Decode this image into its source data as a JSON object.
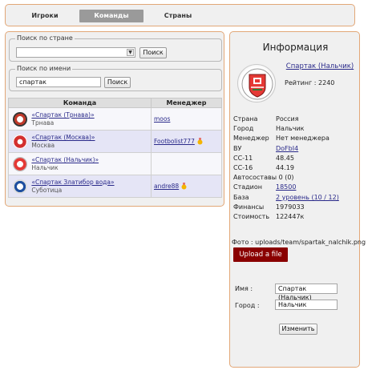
{
  "tabs": [
    {
      "label": "Игроки",
      "active": false
    },
    {
      "label": "Команды",
      "active": true
    },
    {
      "label": "Страны",
      "active": false
    }
  ],
  "search_country": {
    "legend": "Поиск по стране",
    "value": "",
    "button": "Поиск"
  },
  "search_name": {
    "legend": "Поиск по имени",
    "value": "спартак",
    "button": "Поиск"
  },
  "table": {
    "headers": [
      "Команда",
      "Менеджер"
    ],
    "rows": [
      {
        "name": "«Спартак (Трнава)»",
        "city": "Трнава",
        "manager": "moos",
        "medal": false,
        "logo_color": "#c0392b"
      },
      {
        "name": "«Спартак (Москва)»",
        "city": "Москва",
        "manager": "Footbolist777",
        "medal": true,
        "logo_color": "#d32f2f"
      },
      {
        "name": "«Спартак (Нальчик)»",
        "city": "Нальчик",
        "manager": "",
        "medal": false,
        "logo_color": "#e53935"
      },
      {
        "name": "«Спартак Златибор вода»",
        "city": "Суботица",
        "manager": "andre88",
        "medal": true,
        "logo_color": "#1e4fa0"
      }
    ]
  },
  "info": {
    "title": "Информация",
    "team": "Спартак (Нальчик)",
    "rating": "Рейтинг : 2240",
    "fields": [
      {
        "k": "Страна",
        "v": "Россия",
        "link": false
      },
      {
        "k": "Город",
        "v": "Нальчик",
        "link": false
      },
      {
        "k": "Менеджер",
        "v": "Нет менеджера",
        "link": false
      },
      {
        "k": "ВУ",
        "v": "DoFbI4",
        "link": true
      },
      {
        "k": "СС-11",
        "v": "48.45",
        "link": false
      },
      {
        "k": "СС-16",
        "v": "44.19",
        "link": false
      },
      {
        "k": "Автосоставы 0 (0)",
        "v": "",
        "link": false
      },
      {
        "k": "Стадион",
        "v": "18500",
        "link": true
      },
      {
        "k": "База",
        "v": "2 уровень (10 / 12)",
        "link": true
      },
      {
        "k": "Финансы",
        "v": "1979033",
        "link": false
      },
      {
        "k": "Стоимость",
        "v": "122447к",
        "link": false
      }
    ],
    "photo": "Фото : uploads/team/spartak_nalchik.png",
    "upload_button": "Upload a file",
    "name_label": "Имя :",
    "name_value": "Спартак (Нальчик)",
    "city_label": "Город :",
    "city_value": "Нальчик",
    "submit": "Изменить"
  },
  "colors": {
    "accent_border": "#e2a777",
    "upload_bg": "#8a0000",
    "link": "#2a2a8a"
  }
}
